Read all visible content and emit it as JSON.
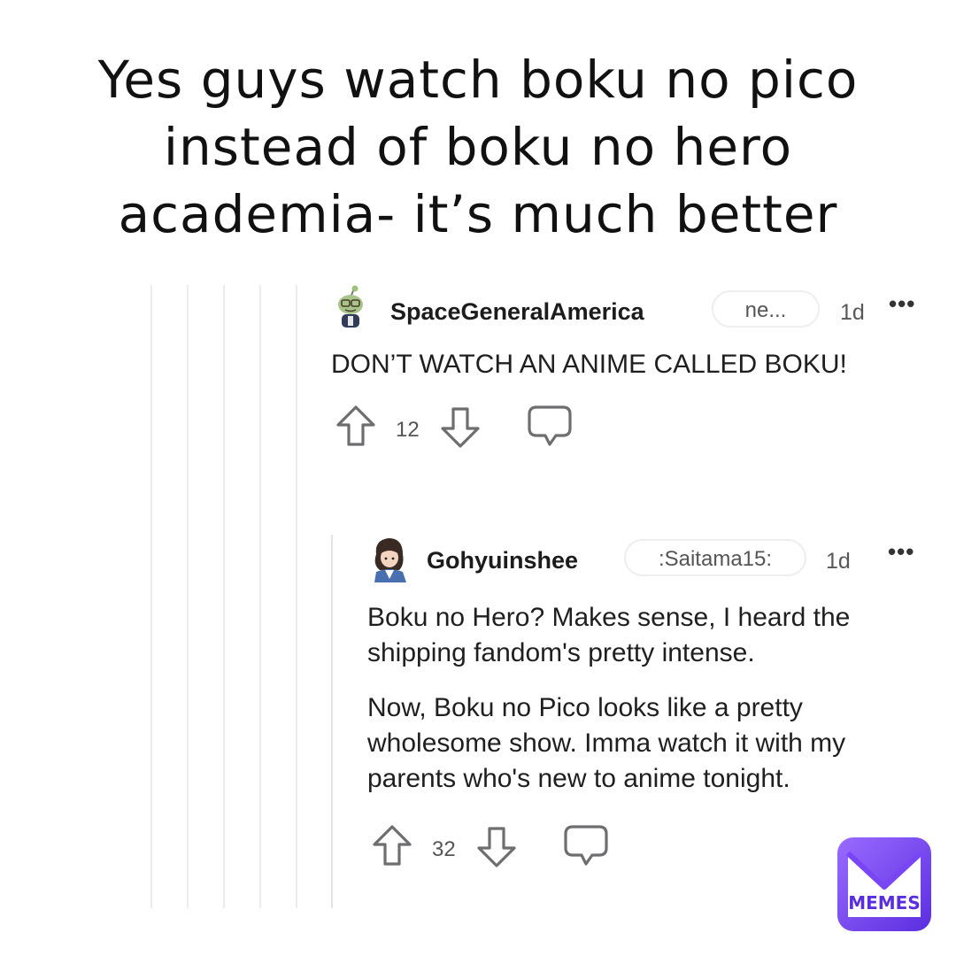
{
  "caption": "Yes guys watch boku no pico instead of boku no hero academia- it’s much better",
  "comments": [
    {
      "username": "SpaceGeneralAmerica",
      "flair": "ne...",
      "age": "1d",
      "more": "•••",
      "body": [
        "DON’T WATCH AN ANIME CALLED BOKU!"
      ],
      "score": "12",
      "avatar_icon": "snoo-avatar-icon"
    },
    {
      "username": "Gohyuinshee",
      "flair": ":Saitama15:",
      "age": "1d",
      "more": "•••",
      "body": [
        "Boku no Hero? Makes sense, I heard the shipping fandom's pretty intense.",
        "Now, Boku no Pico looks like a pretty wholesome show. Imma watch it with my parents who's new to anime tonight."
      ],
      "score": "32",
      "avatar_icon": "anime-character-avatar-icon"
    }
  ],
  "watermark": {
    "text": "MEMES",
    "color_start": "#8d5cf6",
    "color_end": "#5b2fe0"
  },
  "colors": {
    "thread_line": "#ececee",
    "icon_stroke": "#6e6e70"
  }
}
